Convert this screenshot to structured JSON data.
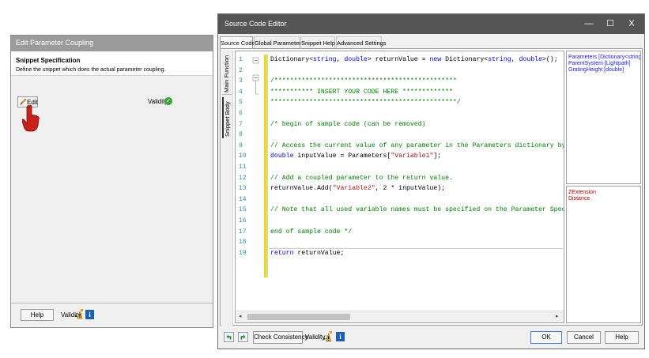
{
  "background_dialog": {
    "title": "Edit Parameter Coupling",
    "heading": "Snippet Specification",
    "description": "Define the snippet which does the actual parameter coupling.",
    "edit_label": "Edit",
    "validity_label": "Validity:",
    "help_label": "Help",
    "validity_bottom_label": "Validity:",
    "info_label": "i"
  },
  "editor": {
    "title": "Source Code Editor",
    "window_buttons": [
      "—",
      "☐",
      "X"
    ],
    "tabs": [
      {
        "label": "Source Code",
        "active": true
      },
      {
        "label": "Global Parameters",
        "active": false
      },
      {
        "label": "Snippet Help",
        "active": false
      },
      {
        "label": "Advanced Settings",
        "active": false
      }
    ],
    "vertical_tabs": [
      "Main Function",
      "Snippet Body"
    ],
    "code_lines": [
      {
        "n": "1",
        "text": "Dictionary<string, double> returnValue = new Dictionary<string, double>();"
      },
      {
        "n": "2",
        "text": ""
      },
      {
        "n": "3",
        "text": "/***********************************************"
      },
      {
        "n": "4",
        "text": "*********** INSERT YOUR CODE HERE *************"
      },
      {
        "n": "5",
        "text": "************************************************/"
      },
      {
        "n": "6",
        "text": ""
      },
      {
        "n": "7",
        "text": "/* begin of sample code (can be removed)"
      },
      {
        "n": "8",
        "text": ""
      },
      {
        "n": "9",
        "text": "// Access the current value of any parameter in the Parameters dictionary by vari"
      },
      {
        "n": "10",
        "text": "double inputValue = Parameters[\"Variable1\"];"
      },
      {
        "n": "11",
        "text": ""
      },
      {
        "n": "12",
        "text": "// Add a coupled parameter to the return value."
      },
      {
        "n": "13",
        "text": "returnValue.Add(\"Variable2\", 2 * inputValue);"
      },
      {
        "n": "14",
        "text": ""
      },
      {
        "n": "15",
        "text": "// Note that all used variable names must be specified on the Parameter Specifica"
      },
      {
        "n": "16",
        "text": ""
      },
      {
        "n": "17",
        "text": "end of sample code */"
      },
      {
        "n": "18",
        "text": ""
      },
      {
        "n": "19",
        "text": "return returnValue;"
      }
    ],
    "parameters": [
      "Parameters [Dictionary<string, do",
      "ParentSystem [Lightpath]",
      "GratingHeight [double]"
    ],
    "outputs": [
      "ZExtension",
      "Distance"
    ],
    "check_consistency_label": "Check Consistency",
    "validity_label": "Validity:",
    "info_label": "i",
    "ok_label": "OK",
    "cancel_label": "Cancel",
    "help_label": "Help"
  },
  "colors": {
    "keyword": "#0000ff",
    "comment": "#008000",
    "string": "#a31515",
    "line_number": "#2b91af",
    "param_blue": "#1a1aff",
    "output_red": "#c00000"
  }
}
